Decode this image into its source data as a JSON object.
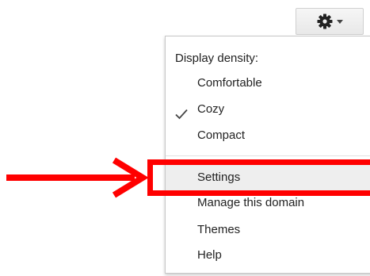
{
  "toolbar": {
    "gear_icon": "gear-icon",
    "dropdown_icon": "caret-down-icon"
  },
  "menu": {
    "heading": "Display density:",
    "density_options": [
      {
        "label": "Comfortable",
        "checked": false
      },
      {
        "label": "Cozy",
        "checked": true
      },
      {
        "label": "Compact",
        "checked": false
      }
    ],
    "items": [
      {
        "label": "Settings",
        "highlighted": true
      },
      {
        "label": "Manage this domain"
      },
      {
        "label": "Themes"
      },
      {
        "label": "Help"
      }
    ]
  },
  "colors": {
    "annotation": "#ff0000",
    "highlight": "#eeeeee",
    "text": "#222222"
  }
}
